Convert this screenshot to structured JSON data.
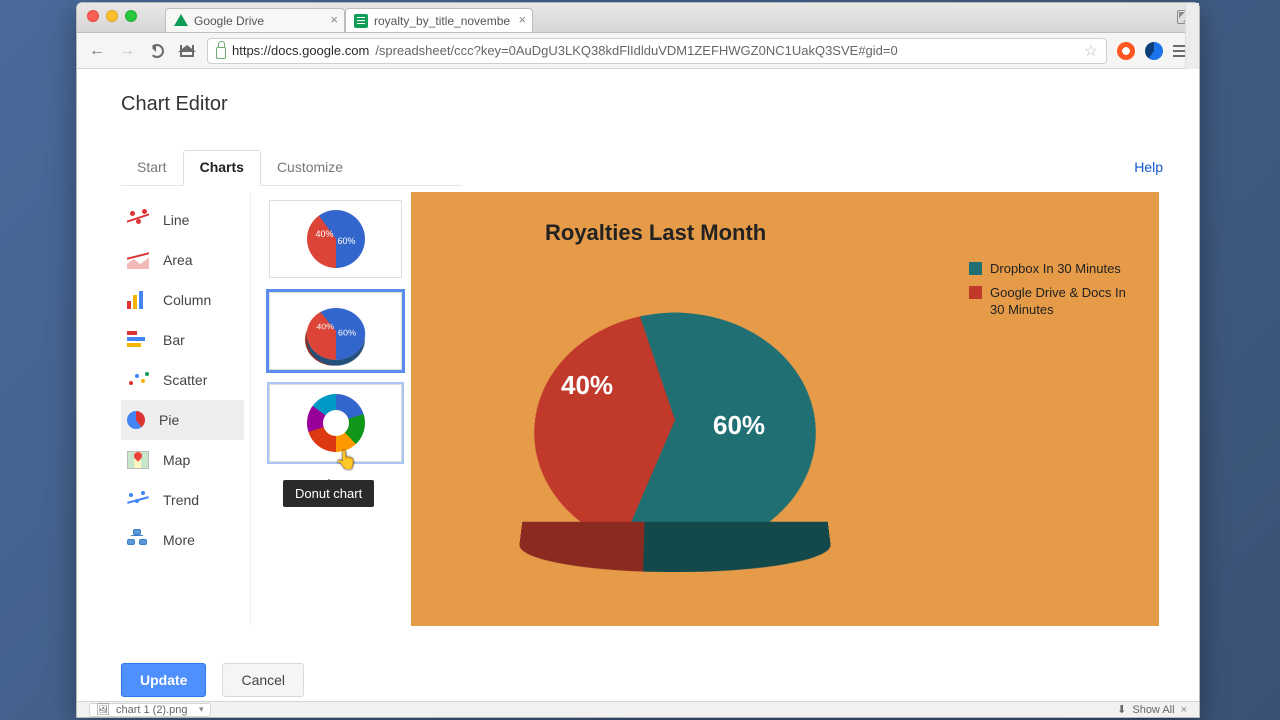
{
  "browser": {
    "tabs": [
      {
        "title": "Google Drive"
      },
      {
        "title": "royalty_by_title_novembe"
      }
    ],
    "url_host": "https://docs.google.com",
    "url_path": "/spreadsheet/ccc?key=0AuDgU3LKQ38kdFlIdlduVDM1ZEFHWGZ0NC1UakQ3SVE#gid=0"
  },
  "page": {
    "title": "Chart Editor",
    "help": "Help",
    "tabs": {
      "start": "Start",
      "charts": "Charts",
      "customize": "Customize"
    },
    "types": {
      "line": "Line",
      "area": "Area",
      "column": "Column",
      "bar": "Bar",
      "scatter": "Scatter",
      "pie": "Pie",
      "map": "Map",
      "trend": "Trend",
      "more": "More"
    },
    "subtype_tooltip": "Donut chart",
    "thumb_labels": {
      "p40": "40%",
      "p60": "60%"
    },
    "actions": {
      "update": "Update",
      "cancel": "Cancel"
    }
  },
  "chart_data": {
    "type": "pie",
    "title": "Royalties Last Month",
    "series": [
      {
        "name": "Dropbox In 30 Minutes",
        "value": 60,
        "label": "60%",
        "color": "#1f6f73"
      },
      {
        "name": "Google Drive & Docs In 30 Minutes",
        "value": 40,
        "label": "40%",
        "color": "#c0392b"
      }
    ]
  },
  "download_bar": {
    "file": "chart 1 (2).png",
    "show_all": "Show All"
  }
}
